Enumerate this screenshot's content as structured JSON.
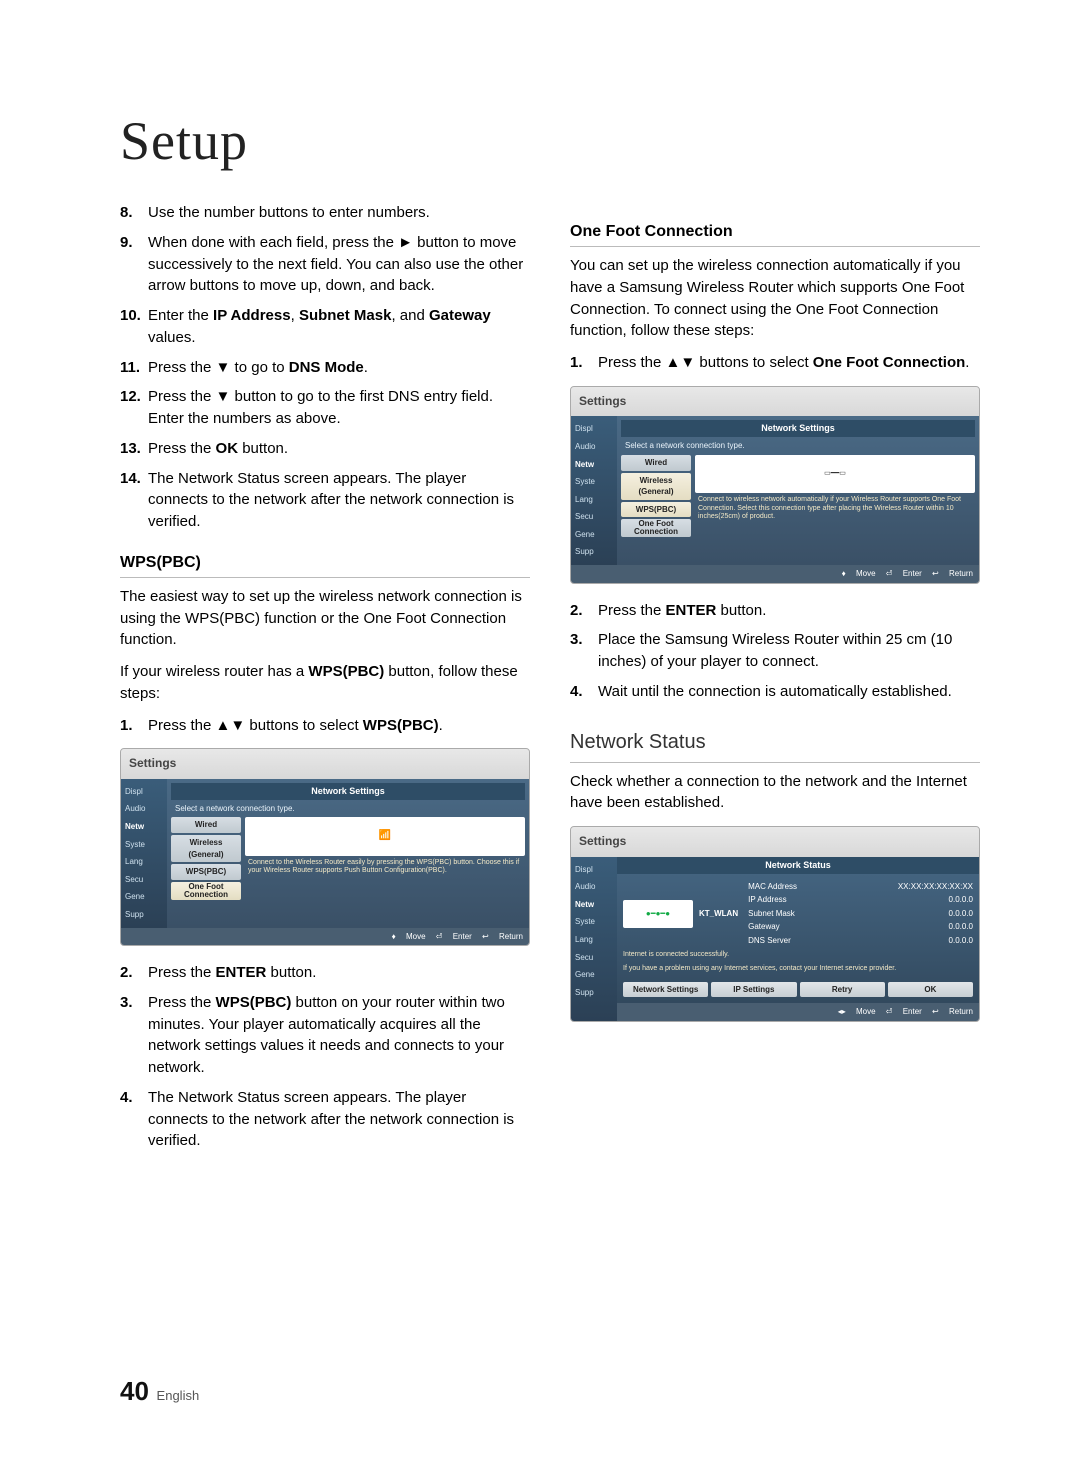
{
  "page": {
    "title": "Setup",
    "number": "40",
    "lang": "English"
  },
  "col1": {
    "steps": [
      {
        "n": "8.",
        "t": "Use the number buttons to enter numbers.",
        "bold": []
      },
      {
        "n": "9.",
        "t": "When done with each field, press the ► button to move successively to the next field. You can also use the other arrow buttons to move up, down, and back."
      },
      {
        "n": "10.",
        "pre": "Enter the ",
        "b1": "IP Address",
        "mid1": ", ",
        "b2": "Subnet Mask",
        "mid2": ", and ",
        "b3": "Gateway",
        "post": " values."
      },
      {
        "n": "11.",
        "pre": "Press the ▼ to go to ",
        "b1": "DNS Mode",
        "post": "."
      },
      {
        "n": "12.",
        "t": "Press the ▼ button to go to the first DNS entry field. Enter the numbers as above."
      },
      {
        "n": "13.",
        "pre": "Press the ",
        "b1": "OK",
        "post": " button."
      },
      {
        "n": "14.",
        "t": "The Network Status screen appears. The player connects to the network after the network connection is verified."
      }
    ],
    "wps": {
      "head": "WPS(PBC)",
      "p1": "The easiest way to set up the wireless network connection is using the WPS(PBC) function or the One Foot Connection function.",
      "p2a": "If your wireless router has a ",
      "p2b": "WPS(PBC)",
      "p2c": " button, follow these steps:",
      "step1a": "Press the ▲▼ buttons to select ",
      "step1b": "WPS(PBC)",
      "step1c": ".",
      "step2a": "Press the ",
      "step2b": "ENTER",
      "step2c": " button.",
      "step3a": "Press the ",
      "step3b": "WPS(PBC)",
      "step3c": " button on your router within two minutes. Your player automatically acquires all the network settings values it needs and connects to your network.",
      "step4": "The Network Status screen appears. The player connects to the network after the network connection is verified."
    },
    "tv": {
      "hdr": "Settings",
      "banner": "Network Settings",
      "sub": "Select a network connection type.",
      "side": [
        "Displ",
        "Audio",
        "Netw",
        "Syste",
        "Lang",
        "Secu",
        "Gene",
        "Supp"
      ],
      "opts": [
        "Wired",
        "Wireless (General)",
        "WPS(PBC)",
        "One Foot Connection"
      ],
      "desc": "Connect to the Wireless Router easily by pressing the WPS(PBC) button. Choose this if your Wireless Router supports Push Button Configuration(PBC).",
      "btns": {
        "move": "Move",
        "enter": "Enter",
        "ret": "Return"
      }
    }
  },
  "col2": {
    "ofc": {
      "head": "One Foot Connection",
      "p": "You can set up the wireless connection automatically if you have a Samsung Wireless Router which supports One Foot Connection. To connect using the One Foot Connection function, follow these steps:",
      "step1a": "Press the ▲▼ buttons to select ",
      "step1b": "One Foot Connection",
      "step1c": ".",
      "step2a": "Press the ",
      "step2b": "ENTER",
      "step2c": " button.",
      "step3": "Place the Samsung Wireless Router within 25 cm (10 inches) of your player to connect.",
      "step4": "Wait until the connection is automatically established."
    },
    "tv": {
      "hdr": "Settings",
      "banner": "Network Settings",
      "sub": "Select a network connection type.",
      "side": [
        "Displ",
        "Audio",
        "Netw",
        "Syste",
        "Lang",
        "Secu",
        "Gene",
        "Supp"
      ],
      "opts": [
        "Wired",
        "Wireless (General)",
        "WPS(PBC)",
        "One Foot Connection"
      ],
      "desc": "Connect to wireless network automatically if your Wireless Router supports One Foot Connection. Select this connection type after placing the Wireless Router within 10 inches(25cm) of product.",
      "btns": {
        "move": "Move",
        "enter": "Enter",
        "ret": "Return"
      }
    },
    "ns": {
      "head": "Network Status",
      "p": "Check whether a connection to the network and the Internet have been established.",
      "tv": {
        "hdr": "Settings",
        "banner": "Network Status",
        "side": [
          "Displ",
          "Audio",
          "Netw",
          "Syste",
          "Lang",
          "Secu",
          "Gene",
          "Supp"
        ],
        "ssid": "KT_WLAN",
        "rows": [
          {
            "k": "MAC Address",
            "v": "XX:XX:XX:XX:XX:XX"
          },
          {
            "k": "IP Address",
            "v": "0.0.0.0"
          },
          {
            "k": "Subnet Mask",
            "v": "0.0.0.0"
          },
          {
            "k": "Gateway",
            "v": "0.0.0.0"
          },
          {
            "k": "DNS Server",
            "v": "0.0.0.0"
          }
        ],
        "msg1": "Internet is connected successfully.",
        "msg2": "If you have a problem using any Internet services, contact your Internet service provider.",
        "btns": [
          "Network Settings",
          "IP Settings",
          "Retry",
          "OK"
        ],
        "foot": {
          "move": "Move",
          "enter": "Enter",
          "ret": "Return"
        }
      }
    }
  }
}
